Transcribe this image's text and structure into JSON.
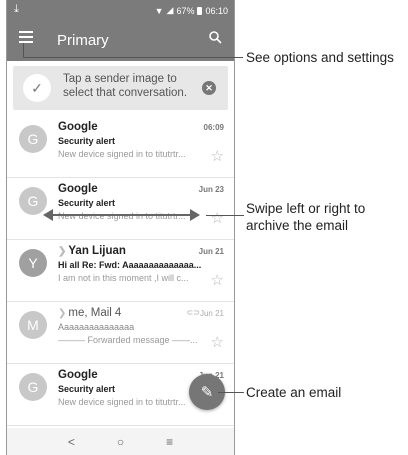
{
  "status_bar": {
    "battery": "67%",
    "time": "06:10"
  },
  "app_bar": {
    "title": "Primary"
  },
  "tip": {
    "text_line1": "Tap a sender image to",
    "text_line2": "select that conversation."
  },
  "emails": [
    {
      "avatar": "G",
      "sender": "Google",
      "date": "06:09",
      "subject": "Security alert",
      "snippet": "New device signed in to titutrtr..."
    },
    {
      "avatar": "G",
      "sender": "Google",
      "date": "Jun 23",
      "subject": "Security alert",
      "snippet": "New device signed in to titutrtr..."
    },
    {
      "avatar": "Y",
      "sender": "Yan Lijuan",
      "date": "Jun 21",
      "subject": "Hi all Re: Fwd: Aaaaaaaaaaaaaa...",
      "snippet": "I am not in this moment ,I will c..."
    },
    {
      "avatar": "M",
      "sender": "me, Mail",
      "count": "4",
      "date": "Jun 21",
      "subject": "Aaaaaaaaaaaaaaa",
      "snippet": "——— Forwarded message ——..."
    },
    {
      "avatar": "G",
      "sender": "Google",
      "date": "Jun 21",
      "subject": "Security alert",
      "snippet": "New device signed in to titutrtr..."
    }
  ],
  "nav": {
    "back": "<",
    "home": "○",
    "recent": "≡"
  },
  "callouts": {
    "options": "See options and settings",
    "swipe_line1": "Swipe left or right to",
    "swipe_line2": "archive the email",
    "create": "Create an email"
  },
  "icons": {
    "download": "download-icon",
    "menu": "menu-icon",
    "search": "search-icon",
    "check": "check-icon",
    "close": "close-icon",
    "star": "star-icon",
    "compose": "pencil-icon"
  }
}
